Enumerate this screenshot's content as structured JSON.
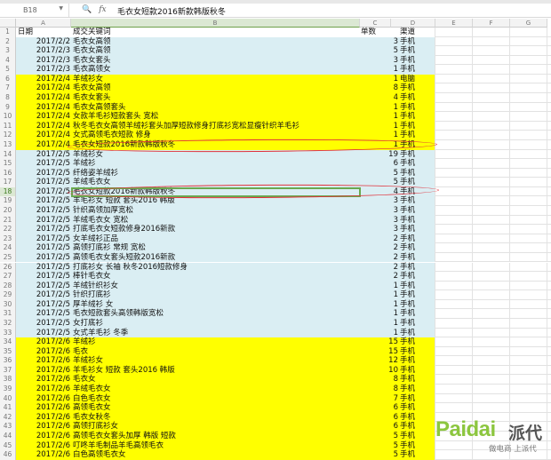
{
  "formula_bar": {
    "cell_ref": "B18",
    "fx_label": "fx",
    "value": "毛衣女短款2016新款韩版秋冬"
  },
  "columns": [
    "A",
    "B",
    "C",
    "D",
    "E",
    "F",
    "G"
  ],
  "header_row": {
    "date": "日期",
    "keyword": "成交关键词",
    "count": "单数",
    "channel": "渠道"
  },
  "colors": {
    "yellow": "#ffff00",
    "blue": "#daeef3",
    "select": "#6aa84f",
    "annotation": "#e0303a"
  },
  "rows": [
    {
      "d": "2017/2/2",
      "k": "毛衣女高领",
      "n": "3",
      "ch": "手机",
      "bg": "blue"
    },
    {
      "d": "2017/2/3",
      "k": "毛衣女高领",
      "n": "5",
      "ch": "手机",
      "bg": "blue"
    },
    {
      "d": "2017/2/3",
      "k": "毛衣女套头",
      "n": "3",
      "ch": "手机",
      "bg": "blue"
    },
    {
      "d": "2017/2/3",
      "k": "毛衣高领女",
      "n": "1",
      "ch": "手机",
      "bg": "blue"
    },
    {
      "d": "2017/2/4",
      "k": "羊绒衫女",
      "n": "1",
      "ch": "电脑",
      "bg": "yellow"
    },
    {
      "d": "2017/2/4",
      "k": "毛衣女高领",
      "n": "8",
      "ch": "手机",
      "bg": "yellow"
    },
    {
      "d": "2017/2/4",
      "k": "毛衣女套头",
      "n": "4",
      "ch": "手机",
      "bg": "yellow"
    },
    {
      "d": "2017/2/4",
      "k": "毛衣女高领套头",
      "n": "1",
      "ch": "手机",
      "bg": "yellow"
    },
    {
      "d": "2017/2/4",
      "k": "女款羊毛衫短款套头 宽松",
      "n": "1",
      "ch": "手机",
      "bg": "yellow"
    },
    {
      "d": "2017/2/4",
      "k": "秋冬毛衣女高领羊绒衫套头加厚短款修身打底衫宽松显瘦针织羊毛衫",
      "n": "1",
      "ch": "手机",
      "bg": "yellow"
    },
    {
      "d": "2017/2/4",
      "k": "女式高领毛衣短款 修身",
      "n": "1",
      "ch": "手机",
      "bg": "yellow"
    },
    {
      "d": "2017/2/4",
      "k": "毛衣女短款2016新款韩版秋冬",
      "n": "1",
      "ch": "手机",
      "bg": "yellow"
    },
    {
      "d": "2017/2/5",
      "k": "羊绒衫女",
      "n": "19",
      "ch": "手机",
      "bg": "blue"
    },
    {
      "d": "2017/2/5",
      "k": "羊绒衫",
      "n": "6",
      "ch": "手机",
      "bg": "blue"
    },
    {
      "d": "2017/2/5",
      "k": "纤络姿羊绒衫",
      "n": "5",
      "ch": "手机",
      "bg": "blue"
    },
    {
      "d": "2017/2/5",
      "k": "羊绒毛衣女",
      "n": "5",
      "ch": "手机",
      "bg": "blue"
    },
    {
      "d": "2017/2/5",
      "k": "毛衣女短款2016新款韩版秋冬",
      "n": "4",
      "ch": "手机",
      "bg": "blue"
    },
    {
      "d": "2017/2/5",
      "k": "羊毛衫女 短款 套头2016 韩版",
      "n": "3",
      "ch": "手机",
      "bg": "blue"
    },
    {
      "d": "2017/2/5",
      "k": "针织高领加厚宽松",
      "n": "3",
      "ch": "手机",
      "bg": "blue"
    },
    {
      "d": "2017/2/5",
      "k": "羊绒毛衣女 宽松",
      "n": "3",
      "ch": "手机",
      "bg": "blue"
    },
    {
      "d": "2017/2/5",
      "k": "打底毛衣女短款修身2016新款",
      "n": "3",
      "ch": "手机",
      "bg": "blue"
    },
    {
      "d": "2017/2/5",
      "k": "女羊绒衫正品",
      "n": "2",
      "ch": "手机",
      "bg": "blue"
    },
    {
      "d": "2017/2/5",
      "k": "高领打底衫 常规 宽松",
      "n": "2",
      "ch": "手机",
      "bg": "blue"
    },
    {
      "d": "2017/2/5",
      "k": "高领毛衣女套头短款2016新款",
      "n": "2",
      "ch": "手机",
      "bg": "blue"
    },
    {
      "d": "2017/2/5",
      "k": "打底衫女 长袖 秋冬2016短款修身",
      "n": "2",
      "ch": "手机",
      "bg": "blue"
    },
    {
      "d": "2017/2/5",
      "k": "棒针毛衣女",
      "n": "2",
      "ch": "手机",
      "bg": "blue"
    },
    {
      "d": "2017/2/5",
      "k": "羊绒针织衫女",
      "n": "1",
      "ch": "手机",
      "bg": "blue"
    },
    {
      "d": "2017/2/5",
      "k": "针织打底衫",
      "n": "1",
      "ch": "手机",
      "bg": "blue"
    },
    {
      "d": "2017/2/5",
      "k": "厚羊绒衫 女",
      "n": "1",
      "ch": "手机",
      "bg": "blue"
    },
    {
      "d": "2017/2/5",
      "k": "毛衣短款套头高领韩版宽松",
      "n": "1",
      "ch": "手机",
      "bg": "blue"
    },
    {
      "d": "2017/2/5",
      "k": "女打底衫",
      "n": "1",
      "ch": "手机",
      "bg": "blue"
    },
    {
      "d": "2017/2/5",
      "k": "女式羊毛衫 冬季",
      "n": "1",
      "ch": "手机",
      "bg": "blue"
    },
    {
      "d": "2017/2/6",
      "k": "羊绒衫",
      "n": "15",
      "ch": "手机",
      "bg": "yellow"
    },
    {
      "d": "2017/2/6",
      "k": "毛衣",
      "n": "15",
      "ch": "手机",
      "bg": "yellow"
    },
    {
      "d": "2017/2/6",
      "k": "羊绒衫女",
      "n": "12",
      "ch": "手机",
      "bg": "yellow"
    },
    {
      "d": "2017/2/6",
      "k": "羊毛衫女 短款 套头2016 韩版",
      "n": "10",
      "ch": "手机",
      "bg": "yellow"
    },
    {
      "d": "2017/2/6",
      "k": "毛衣女",
      "n": "8",
      "ch": "手机",
      "bg": "yellow"
    },
    {
      "d": "2017/2/6",
      "k": "羊绒毛衣女",
      "n": "8",
      "ch": "手机",
      "bg": "yellow"
    },
    {
      "d": "2017/2/6",
      "k": "白色毛衣女",
      "n": "7",
      "ch": "手机",
      "bg": "yellow"
    },
    {
      "d": "2017/2/6",
      "k": "高领毛衣女",
      "n": "6",
      "ch": "手机",
      "bg": "yellow"
    },
    {
      "d": "2017/2/6",
      "k": "毛衣女秋冬",
      "n": "6",
      "ch": "手机",
      "bg": "yellow"
    },
    {
      "d": "2017/2/6",
      "k": "高领打底衫女",
      "n": "6",
      "ch": "手机",
      "bg": "yellow"
    },
    {
      "d": "2017/2/6",
      "k": "高领毛衣女套头加厚 韩版 短款",
      "n": "5",
      "ch": "手机",
      "bg": "yellow"
    },
    {
      "d": "2017/2/6",
      "k": "叮咚羊毛制品羊毛高领毛衣",
      "n": "5",
      "ch": "手机",
      "bg": "yellow"
    },
    {
      "d": "2017/2/6",
      "k": "白色高领毛衣女",
      "n": "5",
      "ch": "手机",
      "bg": "yellow"
    }
  ],
  "watermark": {
    "brand": "Paidai",
    "brand_cn": "派代",
    "tagline": "做电商 上派代"
  }
}
